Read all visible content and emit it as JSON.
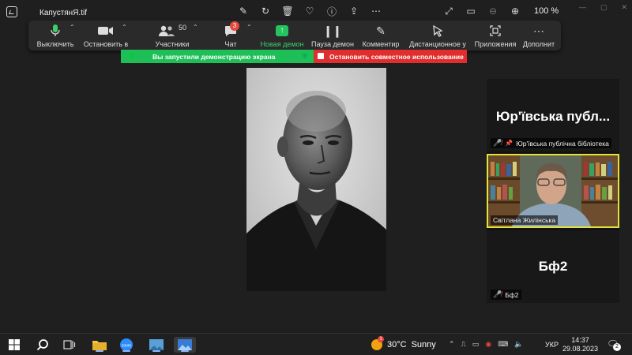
{
  "viewer": {
    "file_name": "КапустянЯ.tif",
    "zoom": "100 %"
  },
  "toolbar": {
    "mute_label": "Выключить",
    "video_label": "Остановить в",
    "participants_label": "Участники",
    "participants_count": "50",
    "chat_label": "Чат",
    "chat_badge": "3",
    "share_label": "Новая демон",
    "pause_label": "Пауза демон",
    "annotate_label": "Комментир",
    "remote_label": "Дистанционное у",
    "apps_label": "Приложения",
    "more_label": "Дополнит"
  },
  "share_bar": {
    "status": "Вы запустили демонстрацию экрана",
    "stop": "Остановить совместное использование"
  },
  "participants": [
    {
      "big_name": "Юр'ївська публ...",
      "label": "Юр'ївська публічна бібліотека"
    },
    {
      "label": "Світлана Жилінська"
    },
    {
      "big_name": "Бф2",
      "label": "Бф2"
    }
  ],
  "taskbar": {
    "temperature": "30°C",
    "weather": "Sunny",
    "weather_badge": "1",
    "language": "УКР",
    "time": "14:37",
    "date": "29.08.2023",
    "notifications": "2"
  },
  "colors": {
    "accent_green": "#1fbf57",
    "stop_red": "#e02d2d",
    "active_speaker": "#e3e33a"
  }
}
